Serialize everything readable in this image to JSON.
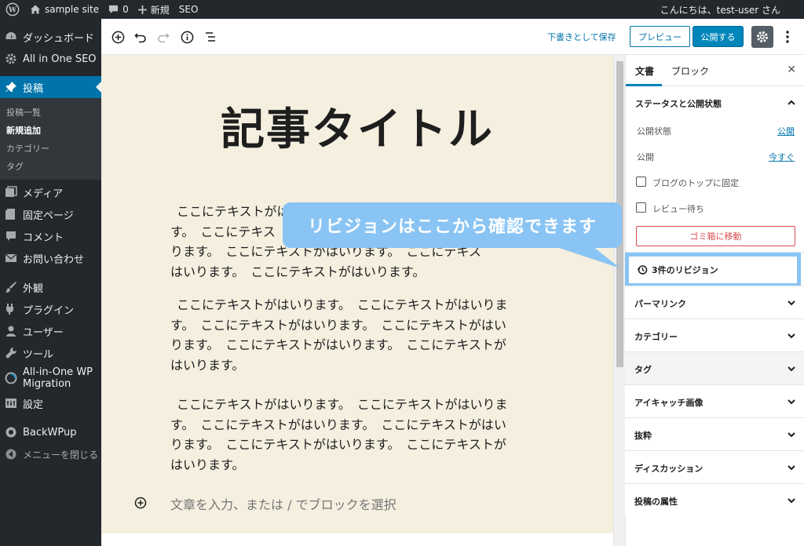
{
  "adminbar": {
    "site_name": "sample site",
    "comments_count": "0",
    "new_label": "新規",
    "seo_label": "SEO",
    "greeting": "こんにちは、test-user さん"
  },
  "sidebar": {
    "items": [
      {
        "label": "ダッシュボード",
        "icon": "dashboard-icon"
      },
      {
        "label": "All in One SEO",
        "icon": "gear-icon"
      },
      {
        "label": "投稿",
        "icon": "pin-icon"
      },
      {
        "label": "メディア",
        "icon": "media-icon"
      },
      {
        "label": "固定ページ",
        "icon": "page-icon"
      },
      {
        "label": "コメント",
        "icon": "comment-icon"
      },
      {
        "label": "お問い合わせ",
        "icon": "mail-icon"
      },
      {
        "label": "外観",
        "icon": "brush-icon"
      },
      {
        "label": "プラグイン",
        "icon": "plugin-icon"
      },
      {
        "label": "ユーザー",
        "icon": "user-icon"
      },
      {
        "label": "ツール",
        "icon": "wrench-icon"
      },
      {
        "label": "All-in-One WP Migration",
        "label_line1": "All-in-One WP",
        "label_line2": "Migration",
        "icon": "migration-icon"
      },
      {
        "label": "設定",
        "icon": "settings-icon"
      },
      {
        "label": "BackWPup",
        "icon": "backwpup-icon"
      },
      {
        "label": "メニューを閉じる",
        "icon": "collapse-icon"
      }
    ],
    "submenu": [
      "投稿一覧",
      "新規追加",
      "カテゴリー",
      "タグ"
    ]
  },
  "header": {
    "save_draft": "下書きとして保存",
    "preview": "プレビュー",
    "publish": "公開する"
  },
  "post": {
    "title": "記事タイトル",
    "paragraph1_lines": [
      "ここにテキストがはいりま",
      "す。　ここにテキス",
      "ります。　ここにテキストがはいります。　ここにテキス",
      "はいります。　ここにテキストがはいります。"
    ],
    "paragraph2_lines": [
      "ここにテキストがはいります。　ここにテキストがはいりま",
      "す。　ここにテキストがはいります。　ここにテキストがはい",
      "ります。　ここにテキストがはいります。　ここにテキストが",
      "はいります。"
    ],
    "paragraph3_lines": [
      "ここにテキストがはいります。　ここにテキストがはいりま",
      "す。　ここにテキストがはいります。　ここにテキストがはい",
      "ります。　ここにテキストがはいります。　ここにテキストが",
      "はいります。"
    ],
    "block_placeholder": "文章を入力、または / でブロックを選択"
  },
  "callout": {
    "text": "リビジョンはここから確認できます"
  },
  "panel": {
    "tab_document": "文書",
    "tab_block": "ブロック",
    "status_title": "ステータスと公開状態",
    "visibility_label": "公開状態",
    "visibility_value": "公開",
    "publish_label": "公開",
    "publish_value": "今すぐ",
    "sticky_label": "ブログのトップに固定",
    "pending_label": "レビュー待ち",
    "trash_button": "ゴミ箱に移動",
    "revisions": "3件のリビジョン",
    "sections": [
      "パーマリンク",
      "カテゴリー",
      "タグ",
      "アイキャッチ画像",
      "抜粋",
      "ディスカッション",
      "投稿の属性"
    ]
  },
  "colors": {
    "admin_dark": "#23282d",
    "accent_blue": "#0085ba",
    "content_bg": "#f5efe0",
    "callout_blue": "#89c4f4",
    "trash_red": "#d94f4f"
  }
}
